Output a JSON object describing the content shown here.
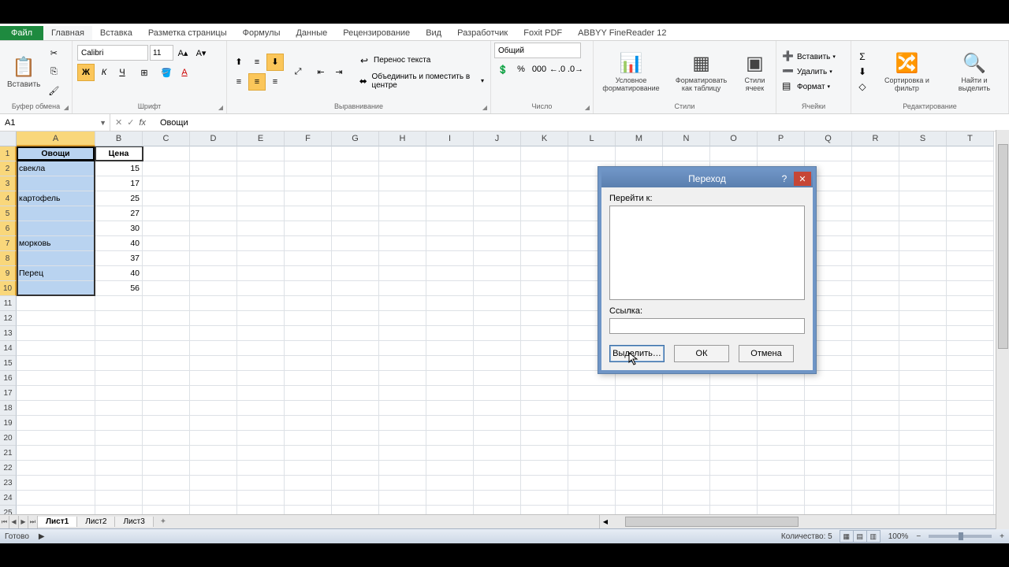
{
  "tabs": {
    "file": "Файл",
    "items": [
      "Главная",
      "Вставка",
      "Разметка страницы",
      "Формулы",
      "Данные",
      "Рецензирование",
      "Вид",
      "Разработчик",
      "Foxit PDF",
      "ABBYY FineReader 12"
    ],
    "active_index": 0
  },
  "ribbon": {
    "clipboard": {
      "paste": "Вставить",
      "label": "Буфер обмена"
    },
    "font": {
      "name": "Calibri",
      "size": "11",
      "label": "Шрифт"
    },
    "align": {
      "wrap": "Перенос текста",
      "merge": "Объединить и поместить в центре",
      "label": "Выравнивание"
    },
    "number": {
      "format": "Общий",
      "label": "Число"
    },
    "styles": {
      "cond": "Условное форматирование",
      "table": "Форматировать как таблицу",
      "cell": "Стили ячеек",
      "label": "Стили"
    },
    "cells": {
      "insert": "Вставить",
      "delete": "Удалить",
      "format": "Формат",
      "label": "Ячейки"
    },
    "editing": {
      "sort": "Сортировка и фильтр",
      "find": "Найти и выделить",
      "label": "Редактирование"
    }
  },
  "namebox": "A1",
  "formula": "Овощи",
  "columns": [
    "A",
    "B",
    "C",
    "D",
    "E",
    "F",
    "G",
    "H",
    "I",
    "J",
    "K",
    "L",
    "M",
    "N",
    "O",
    "P",
    "Q",
    "R",
    "S",
    "T"
  ],
  "selected_col": "A",
  "rows": 25,
  "data": {
    "headers": [
      "Овощи",
      "Цена"
    ],
    "rows": [
      [
        "свекла",
        "15"
      ],
      [
        "",
        "17"
      ],
      [
        "картофель",
        "25"
      ],
      [
        "",
        "27"
      ],
      [
        "",
        "30"
      ],
      [
        "морковь",
        "40"
      ],
      [
        "",
        "37"
      ],
      [
        "Перец",
        "40"
      ],
      [
        "",
        "56"
      ]
    ]
  },
  "sheets": {
    "items": [
      "Лист1",
      "Лист2",
      "Лист3"
    ],
    "active": 0
  },
  "status": {
    "ready": "Готово",
    "count": "Количество: 5",
    "zoom": "100%"
  },
  "dialog": {
    "title": "Переход",
    "goto_label": "Перейти к:",
    "ref_label": "Ссылка:",
    "select_btn": "Выделить…",
    "ok_btn": "ОК",
    "cancel_btn": "Отмена"
  }
}
